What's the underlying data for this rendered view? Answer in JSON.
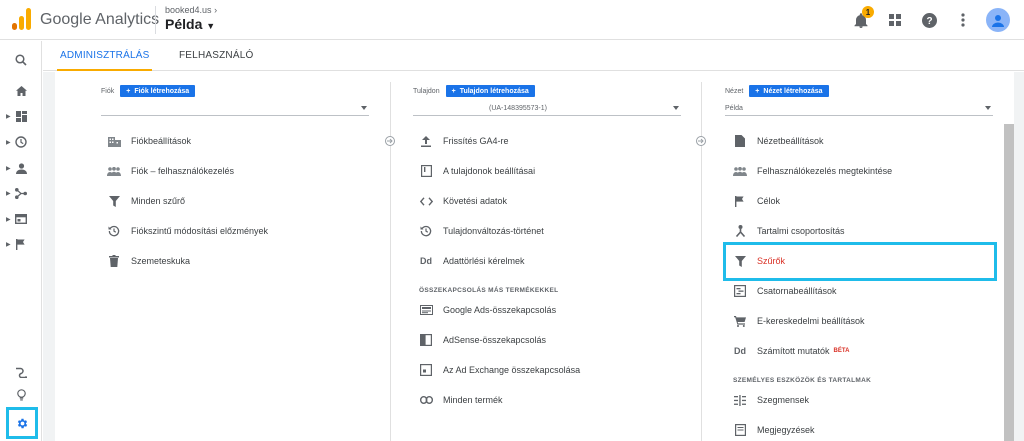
{
  "header": {
    "brand": "Google Analytics",
    "account_site": "booked4.us",
    "account_view": "Példa",
    "notification_count": "1"
  },
  "tabs": [
    {
      "label": "ADMINISZTRÁLÁS",
      "active": true
    },
    {
      "label": "FELHASZNÁLÓ",
      "active": false
    }
  ],
  "account_col": {
    "label": "Fiók",
    "create": "Fiók létrehozása",
    "select_value": "",
    "items": [
      {
        "label": "Fiókbeállítások",
        "icon": "building-icon"
      },
      {
        "label": "Fiók – felhasználókezelés",
        "icon": "people-icon"
      },
      {
        "label": "Minden szűrő",
        "icon": "filter-icon"
      },
      {
        "label": "Fiókszintű módosítási előzmények",
        "icon": "history-icon"
      },
      {
        "label": "Szemeteskuka",
        "icon": "trash-icon"
      }
    ]
  },
  "property_col": {
    "label": "Tulajdon",
    "create": "Tulajdon létrehozása",
    "select_value": "(UA-148395573-1)",
    "items": [
      {
        "label": "Frissítés GA4-re",
        "icon": "upgrade-icon"
      },
      {
        "label": "A tulajdonok beállításai",
        "icon": "property-settings-icon"
      },
      {
        "label": "Követési adatok",
        "icon": "code-icon"
      },
      {
        "label": "Tulajdonváltozás-történet",
        "icon": "history-icon"
      },
      {
        "label": "Adattörlési kérelmek",
        "icon": "dd-icon"
      }
    ],
    "section_title": "ÖSSZEKAPCSOLÁS MÁS TERMÉKEKKEL",
    "links": [
      {
        "label": "Google Ads-összekapcsolás",
        "icon": "ads-icon"
      },
      {
        "label": "AdSense-összekapcsolás",
        "icon": "adsense-icon"
      },
      {
        "label": "Az Ad Exchange összekapcsolása",
        "icon": "adexchange-icon"
      },
      {
        "label": "Minden termék",
        "icon": "link-icon"
      }
    ]
  },
  "view_col": {
    "label": "Nézet",
    "create": "Nézet létrehozása",
    "select_value": "Példa",
    "items": [
      {
        "label": "Nézetbeállítások",
        "icon": "document-icon"
      },
      {
        "label": "Felhasználókezelés megtekintése",
        "icon": "people-icon"
      },
      {
        "label": "Célok",
        "icon": "flag-icon"
      },
      {
        "label": "Tartalmi csoportosítás",
        "icon": "grouping-icon"
      },
      {
        "label": "Szűrők",
        "icon": "filter-icon",
        "highlighted": true
      },
      {
        "label": "Csatornabeállítások",
        "icon": "channel-icon"
      },
      {
        "label": "E-kereskedelmi beállítások",
        "icon": "cart-icon"
      },
      {
        "label": "Számított mutatók",
        "icon": "dd-icon",
        "badge": "BÉTA"
      }
    ],
    "section_title": "SZEMÉLYES ESZKÖZÖK ÉS TARTALMAK",
    "tools": [
      {
        "label": "Szegmensek",
        "icon": "segments-icon"
      },
      {
        "label": "Megjegyzések",
        "icon": "notes-icon"
      }
    ]
  },
  "colors": {
    "accent_blue": "#1a73e8",
    "tab_indicator": "#f9ab00",
    "highlight": "#1fbcea",
    "active_red": "#d93025"
  }
}
